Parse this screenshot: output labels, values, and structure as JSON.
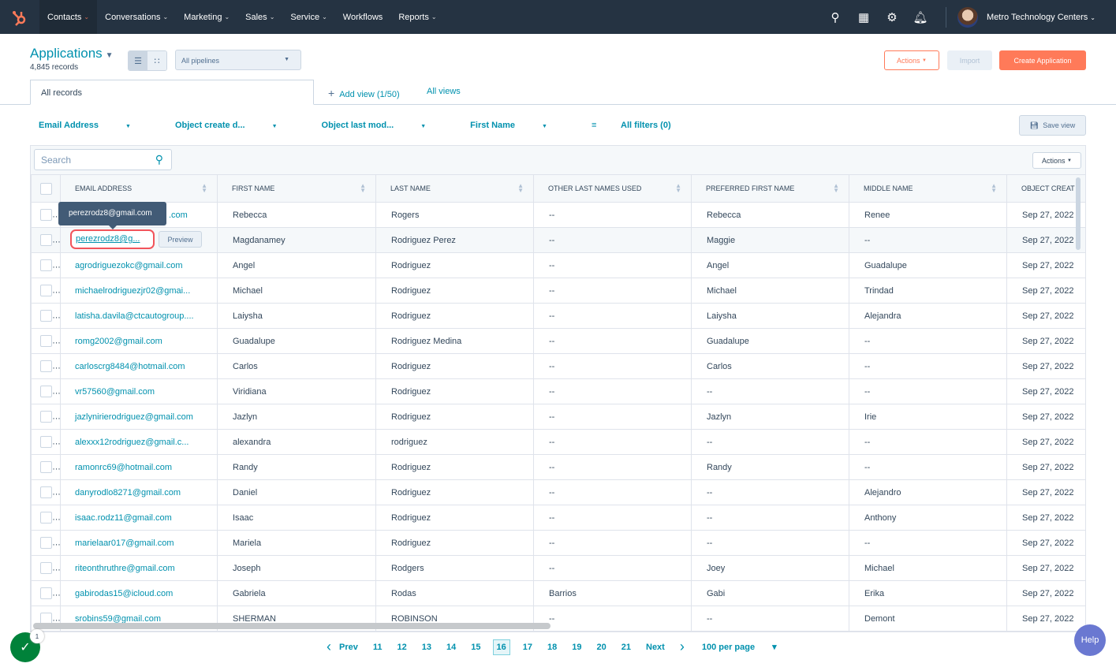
{
  "topnav": {
    "items": [
      {
        "label": "Contacts",
        "active": true
      },
      {
        "label": "Conversations"
      },
      {
        "label": "Marketing"
      },
      {
        "label": "Sales"
      },
      {
        "label": "Service"
      },
      {
        "label": "Workflows",
        "nochev": true
      },
      {
        "label": "Reports"
      }
    ],
    "account": "Metro Technology Centers"
  },
  "header": {
    "title": "Applications",
    "count": "4,845 records",
    "pipeline": "All pipelines",
    "actions": "Actions",
    "import": "Import",
    "create": "Create Application"
  },
  "tabs": {
    "all_records": "All records",
    "add_view": "Add view (1/50)",
    "all_views": "All views"
  },
  "filters": {
    "items": [
      "Email Address",
      "Object create d...",
      "Object last mod...",
      "First Name"
    ],
    "all_filters": "All filters (0)",
    "save_view": "Save view"
  },
  "table": {
    "search_placeholder": "Search",
    "actions": "Actions",
    "columns": [
      "EMAIL ADDRESS",
      "FIRST NAME",
      "LAST NAME",
      "OTHER LAST NAMES USED",
      "PREFERRED FIRST NAME",
      "MIDDLE NAME",
      "OBJECT CREAT"
    ],
    "rows": [
      [
        ".com",
        "Rebecca",
        "Rogers",
        "--",
        "Rebecca",
        "Renee",
        "Sep 27, 2022"
      ],
      [
        "",
        "Magdanamey",
        "Rodriguez Perez",
        "--",
        "Maggie",
        "--",
        "Sep 27, 2022"
      ],
      [
        "agrodriguezokc@gmail.com",
        "Angel",
        "Rodriguez",
        "--",
        "Angel",
        "Guadalupe",
        "Sep 27, 2022"
      ],
      [
        "michaelrodriguezjr02@gmai...",
        "Michael",
        "Rodriguez",
        "--",
        "Michael",
        "Trindad",
        "Sep 27, 2022"
      ],
      [
        "latisha.davila@ctcautogroup....",
        "Laiysha",
        "Rodriguez",
        "--",
        "Laiysha",
        "Alejandra",
        "Sep 27, 2022"
      ],
      [
        "romg2002@gmail.com",
        "Guadalupe",
        "Rodriguez Medina",
        "--",
        "Guadalupe",
        "--",
        "Sep 27, 2022"
      ],
      [
        "carloscrg8484@hotmail.com",
        "Carlos",
        "Rodriguez",
        "--",
        "Carlos",
        "--",
        "Sep 27, 2022"
      ],
      [
        "vr57560@gmail.com",
        "Viridiana",
        "Rodriguez",
        "--",
        "--",
        "--",
        "Sep 27, 2022"
      ],
      [
        "jazlynirierodriguez@gmail.com",
        "Jazlyn",
        "Rodriguez",
        "--",
        "Jazlyn",
        "Irie",
        "Sep 27, 2022"
      ],
      [
        "alexxx12rodriguez@gmail.c...",
        "alexandra",
        "rodriguez",
        "--",
        "--",
        "--",
        "Sep 27, 2022"
      ],
      [
        "ramonrc69@hotmail.com",
        "Randy",
        "Rodriguez",
        "--",
        "Randy",
        "--",
        "Sep 27, 2022"
      ],
      [
        "danyrodlo8271@gmail.com",
        "Daniel",
        "Rodriguez",
        "--",
        "--",
        "Alejandro",
        "Sep 27, 2022"
      ],
      [
        "isaac.rodz11@gmail.com",
        "Isaac",
        "Rodriguez",
        "--",
        "--",
        "Anthony",
        "Sep 27, 2022"
      ],
      [
        "marielaar017@gmail.com",
        "Mariela",
        "Rodriguez",
        "--",
        "--",
        "--",
        "Sep 27, 2022"
      ],
      [
        "riteonthruthre@gmail.com",
        "Joseph",
        "Rodgers",
        "--",
        "Joey",
        "Michael",
        "Sep 27, 2022"
      ],
      [
        "gabirodas15@icloud.com",
        "Gabriela",
        "Rodas",
        "Barrios",
        "Gabi",
        "Erika",
        "Sep 27, 2022"
      ],
      [
        "srobins59@gmail.com",
        "SHERMAN",
        "ROBINSON",
        "--",
        "--",
        "Demont",
        "Sep 27, 2022"
      ]
    ],
    "tooltip": "perezrodz8@gmail.com",
    "selected_email": "perezrodz8@g...",
    "preview": "Preview"
  },
  "pagination": {
    "prev": "Prev",
    "next": "Next",
    "pages": [
      "11",
      "12",
      "13",
      "14",
      "15",
      "16",
      "17",
      "18",
      "19",
      "20",
      "21"
    ],
    "current": "16",
    "per_page": "100 per page"
  },
  "notifications": {
    "badge": "1"
  },
  "help": "Help",
  "colors": {
    "nav": "#253342",
    "accent": "#0091ae",
    "brand": "#ff7a59"
  }
}
